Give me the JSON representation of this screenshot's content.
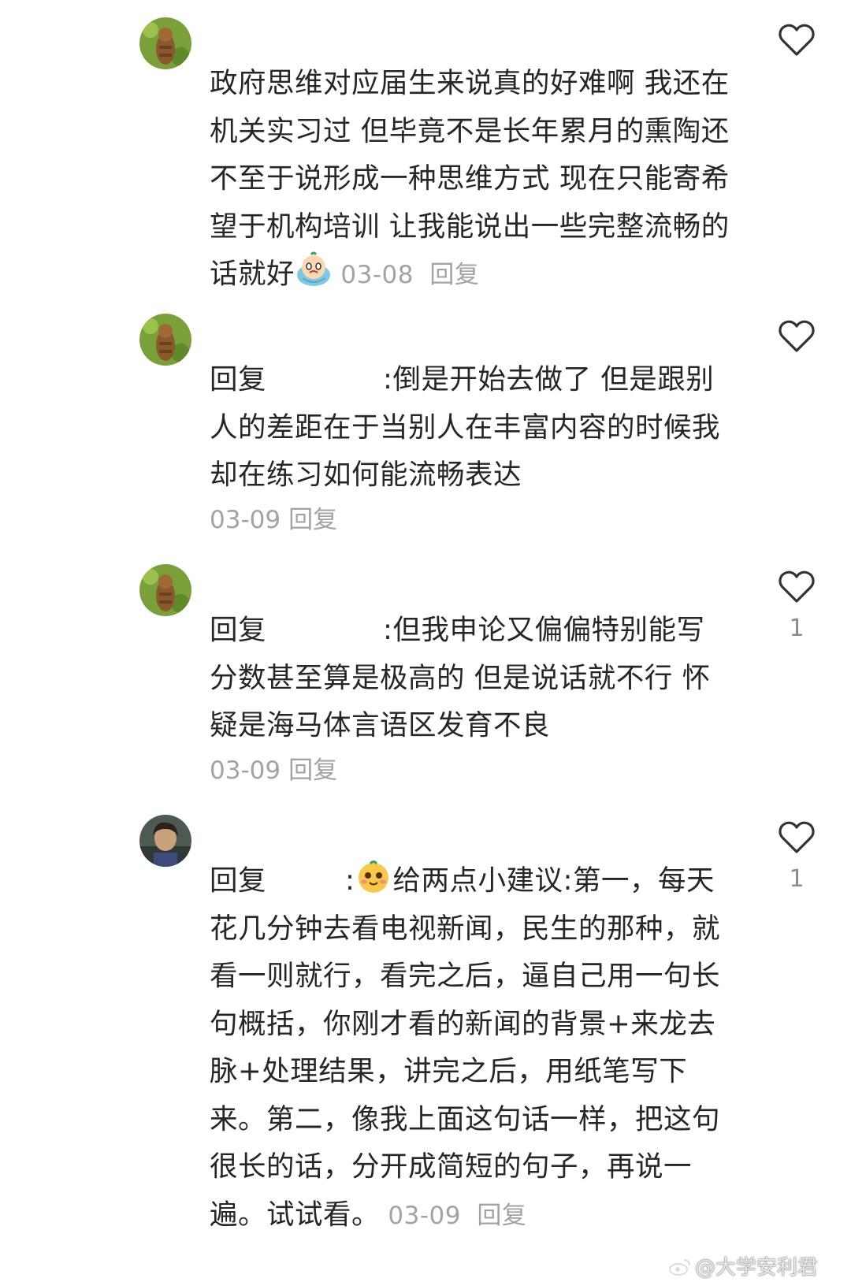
{
  "comments": [
    {
      "username": "",
      "text": "政府思维对应届生来说真的好难啊 我还在机关实习过 但毕竟不是长年累月的熏陶还不至于说形成一种思维方式 现在只能寄希望于机构培训 让我能说出一些完整流畅的话就好",
      "emoji": "crying-face-emoji",
      "date": "03-08",
      "reply_label": "回复",
      "likes": ""
    },
    {
      "username": "",
      "reply_prefix": "回复",
      "mention_separator": ":",
      "text": "倒是开始去做了 但是跟别人的差距在于当别人在丰富内容的时候我却在练习如何能流畅表达",
      "date": "03-09",
      "reply_label": "回复",
      "likes": ""
    },
    {
      "username": "",
      "reply_prefix": "回复",
      "mention_separator": ":",
      "text": "但我申论又偏偏特别能写 分数甚至算是极高的 但是说话就不行 怀疑是海马体言语区发育不良",
      "date": "03-09",
      "reply_label": "回复",
      "likes": "1"
    },
    {
      "username": "",
      "reply_prefix": "回复",
      "mention_separator": ":",
      "emoji": "smiling-face-emoji",
      "text": "给两点小建议:第一，每天花几分钟去看电视新闻，民生的那种，就看一则就行，看完之后，逼自己用一句长句概括，你刚才看的新闻的背景+来龙去脉+处理结果，讲完之后，用纸笔写下来。第二，像我上面这句话一样，把这句很长的话，分开成简短的句子，再说一遍。试试看。",
      "date": "03-09",
      "reply_label": "回复",
      "likes": "1"
    }
  ],
  "watermark": "@大学安利君",
  "colors": {
    "text": "#262626",
    "meta": "#a3a3a3",
    "heart_stroke": "#333333"
  }
}
